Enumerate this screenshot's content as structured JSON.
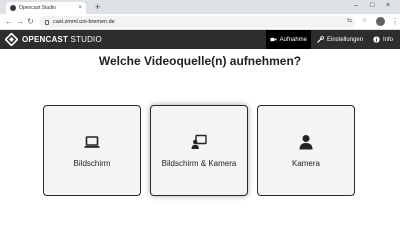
{
  "browser": {
    "tab_title": "Opencast Studio",
    "tab_close": "×",
    "new_tab": "+",
    "url": "cast.zmml.uni-bremen.de",
    "window_controls": [
      "–",
      "□",
      "×"
    ],
    "nav_icons": [
      "back-icon",
      "forward-icon",
      "reload-icon"
    ]
  },
  "app": {
    "brand_bold": "OPENCAST",
    "brand_light": " STUDIO",
    "nav": [
      {
        "label": "Aufnahme",
        "icon": "video-camera-icon",
        "active": true
      },
      {
        "label": "Einstellungen",
        "icon": "wrench-icon",
        "active": false
      },
      {
        "label": "Info",
        "icon": "info-icon",
        "active": false
      }
    ]
  },
  "main": {
    "question": "Welche Videoquelle(n) aufnehmen?",
    "options": [
      {
        "label": "Bildschirm",
        "icon": "laptop-icon"
      },
      {
        "label": "Bildschirm & Kamera",
        "icon": "screen-and-user-icon"
      },
      {
        "label": "Kamera",
        "icon": "user-icon"
      }
    ]
  },
  "colors": {
    "header_bg": "#2d2d2d",
    "active_nav_bg": "#000000",
    "card_bg": "#f4f4f4",
    "card_border": "#2a2a2a"
  }
}
